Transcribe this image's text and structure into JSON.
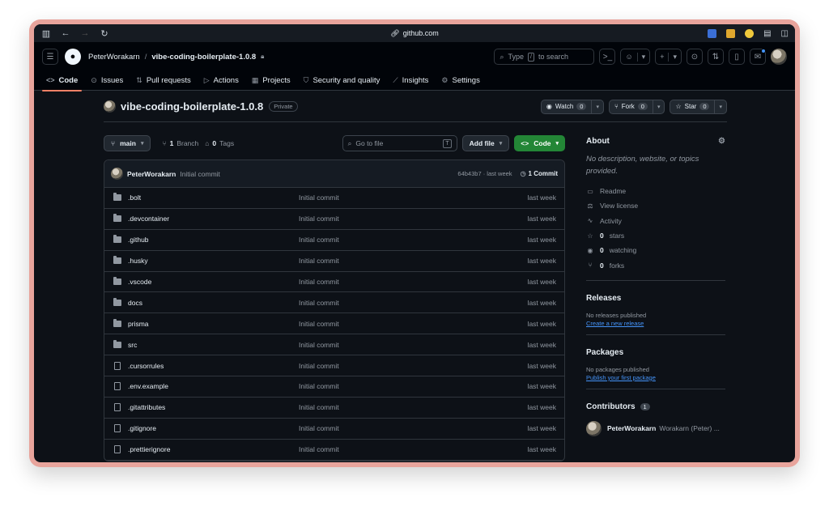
{
  "browser": {
    "url": "github.com"
  },
  "header": {
    "owner": "PeterWorakarn",
    "separator": "/",
    "repo": "vibe-coding-boilerplate-1.0.8",
    "search_label": "Type",
    "search_key": "/",
    "search_suffix": "to search"
  },
  "nav": {
    "tabs": [
      {
        "label": "Code",
        "icon": "code-icon"
      },
      {
        "label": "Issues",
        "icon": "issue-icon"
      },
      {
        "label": "Pull requests",
        "icon": "pull-request-icon"
      },
      {
        "label": "Actions",
        "icon": "play-icon"
      },
      {
        "label": "Projects",
        "icon": "table-icon"
      },
      {
        "label": "Security and quality",
        "icon": "shield-icon"
      },
      {
        "label": "Insights",
        "icon": "graph-icon"
      },
      {
        "label": "Settings",
        "icon": "gear-icon"
      }
    ]
  },
  "repo": {
    "title": "vibe-coding-boilerplate-1.0.8",
    "visibility": "Private",
    "watch_label": "Watch",
    "watch_count": "0",
    "fork_label": "Fork",
    "fork_count": "0",
    "star_label": "Star",
    "star_count": "0"
  },
  "filebar": {
    "branch": "main",
    "branch_count": "1",
    "branch_label": "Branch",
    "tag_count": "0",
    "tag_label": "Tags",
    "goto_placeholder": "Go to file",
    "goto_key": "T",
    "add_file": "Add file",
    "code": "Code"
  },
  "commit": {
    "author": "PeterWorakarn",
    "message": "Initial commit",
    "sha_time": "64b43b7 · last week",
    "count_label": "1 Commit"
  },
  "files": [
    {
      "name": ".bolt",
      "type": "folder",
      "message": "Initial commit",
      "date": "last week"
    },
    {
      "name": ".devcontainer",
      "type": "folder",
      "message": "Initial commit",
      "date": "last week"
    },
    {
      "name": ".github",
      "type": "folder",
      "message": "Initial commit",
      "date": "last week"
    },
    {
      "name": ".husky",
      "type": "folder",
      "message": "Initial commit",
      "date": "last week"
    },
    {
      "name": ".vscode",
      "type": "folder",
      "message": "Initial commit",
      "date": "last week"
    },
    {
      "name": "docs",
      "type": "folder",
      "message": "Initial commit",
      "date": "last week"
    },
    {
      "name": "prisma",
      "type": "folder",
      "message": "Initial commit",
      "date": "last week"
    },
    {
      "name": "src",
      "type": "folder",
      "message": "Initial commit",
      "date": "last week"
    },
    {
      "name": ".cursorrules",
      "type": "file",
      "message": "Initial commit",
      "date": "last week"
    },
    {
      "name": ".env.example",
      "type": "file",
      "message": "Initial commit",
      "date": "last week"
    },
    {
      "name": ".gitattributes",
      "type": "file",
      "message": "Initial commit",
      "date": "last week"
    },
    {
      "name": ".gitignore",
      "type": "file",
      "message": "Initial commit",
      "date": "last week"
    },
    {
      "name": ".prettierignore",
      "type": "file",
      "message": "Initial commit",
      "date": "last week"
    }
  ],
  "about": {
    "title": "About",
    "description": "No description, website, or topics provided.",
    "items": [
      {
        "icon": "book-icon",
        "value": "",
        "label": "Readme"
      },
      {
        "icon": "scale-icon",
        "value": "",
        "label": "View license"
      },
      {
        "icon": "pulse-icon",
        "value": "",
        "label": "Activity"
      },
      {
        "icon": "star-icon",
        "value": "0",
        "label": "stars"
      },
      {
        "icon": "eye-icon",
        "value": "0",
        "label": "watching"
      },
      {
        "icon": "fork-icon",
        "value": "0",
        "label": "forks"
      }
    ]
  },
  "releases": {
    "title": "Releases",
    "empty": "No releases published",
    "link": "Create a new release"
  },
  "packages": {
    "title": "Packages",
    "empty": "No packages published",
    "link": "Publish your first package"
  },
  "contributors": {
    "title": "Contributors",
    "count": "1",
    "items": [
      {
        "login": "PeterWorakarn",
        "name": "Worakarn (Peter) ..."
      }
    ]
  },
  "colors": {
    "bg": "#0d1117",
    "header_bg": "#010409",
    "accent_green": "#238636",
    "link_blue": "#4493f8",
    "active_tab_underline": "#f78166",
    "frame": "#e8a49c"
  }
}
